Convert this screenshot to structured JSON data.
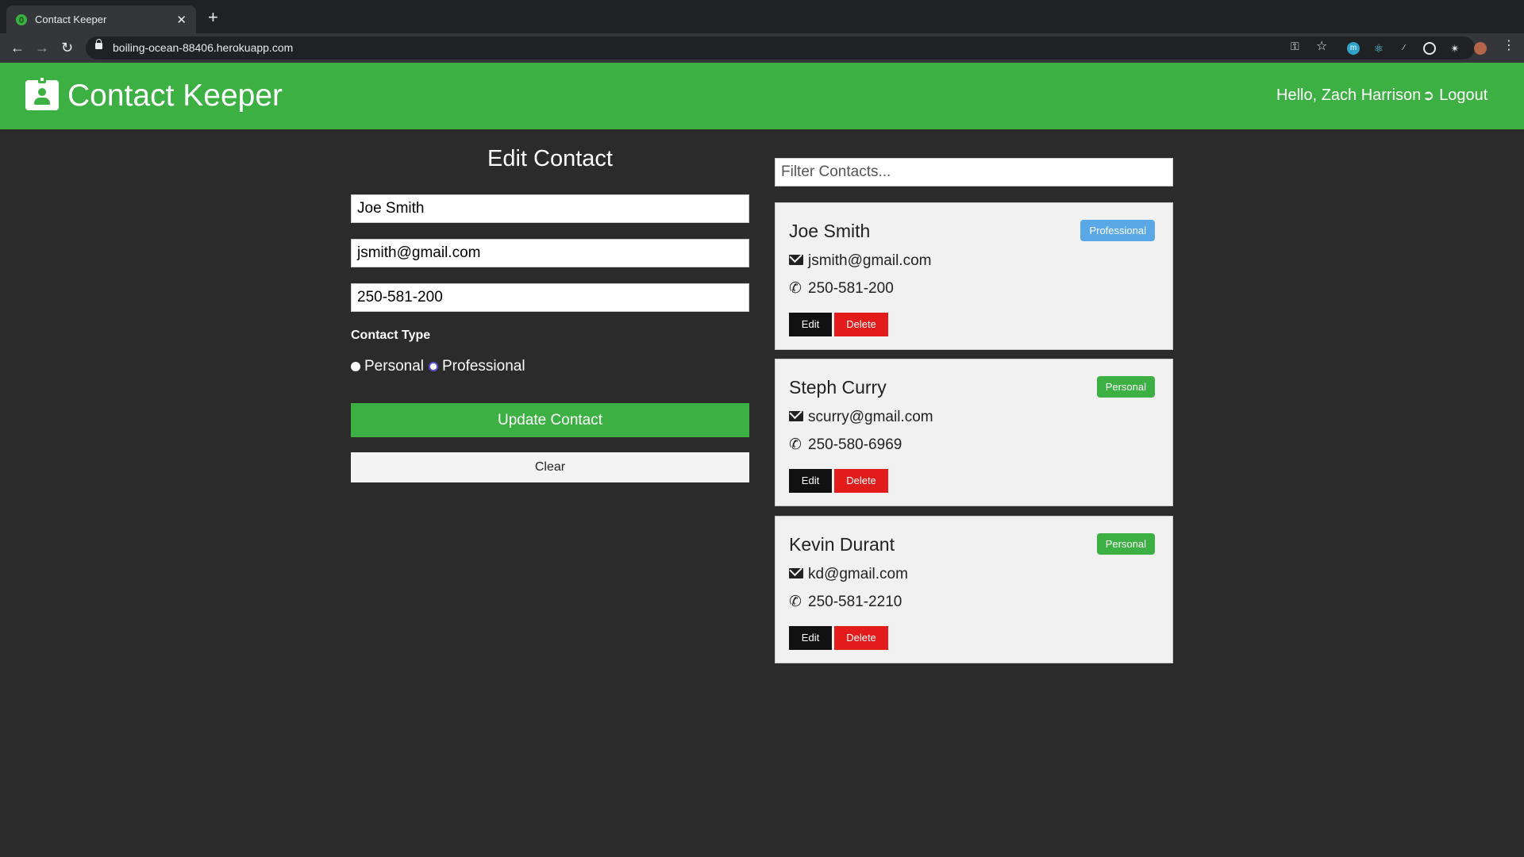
{
  "browser": {
    "tab_title": "Contact Keeper",
    "tab_close": "✕",
    "new_tab": "+",
    "url": "boiling-ocean-88406.herokuapp.com"
  },
  "navbar": {
    "brand": "Contact Keeper",
    "greeting": "Hello, Zach Harrison",
    "logout": "Logout",
    "color": "#3cb043"
  },
  "form": {
    "title": "Edit Contact",
    "name_value": "Joe Smith",
    "email_value": "jsmith@gmail.com",
    "phone_value": "250-581-200",
    "contact_type_label": "Contact Type",
    "radio_personal": "Personal",
    "radio_professional": "Professional",
    "submit_label": "Update Contact",
    "clear_label": "Clear"
  },
  "filter": {
    "placeholder": "Filter Contacts..."
  },
  "contacts": [
    {
      "name": "Joe Smith",
      "type": "Professional",
      "email": "jsmith@gmail.com",
      "phone": "250-581-200",
      "edit": "Edit",
      "delete": "Delete"
    },
    {
      "name": "Steph Curry",
      "type": "Personal",
      "email": "scurry@gmail.com",
      "phone": "250-580-6969",
      "edit": "Edit",
      "delete": "Delete"
    },
    {
      "name": "Kevin Durant",
      "type": "Personal",
      "email": "kd@gmail.com",
      "phone": "250-581-2210",
      "edit": "Edit",
      "delete": "Delete"
    }
  ]
}
